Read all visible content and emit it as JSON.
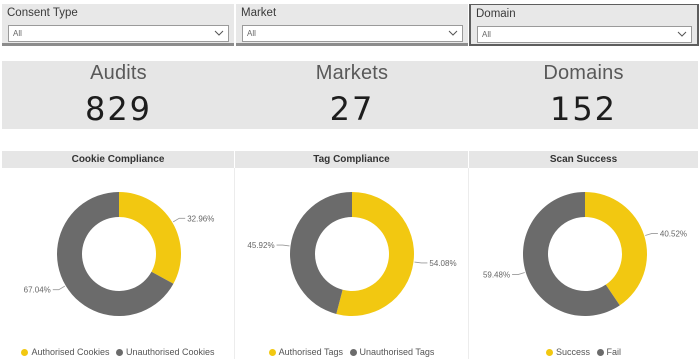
{
  "colors": {
    "accent": "#f2c811",
    "neutral": "#6b6b6b"
  },
  "filters": [
    {
      "label": "Consent Type",
      "value": "All",
      "icon": "chevron-down-icon"
    },
    {
      "label": "Market",
      "value": "All",
      "icon": "chevron-down-icon"
    },
    {
      "label": "Domain",
      "value": "All",
      "icon": "chevron-down-icon"
    }
  ],
  "kpis": [
    {
      "title": "Audits",
      "value": "829"
    },
    {
      "title": "Markets",
      "value": "27"
    },
    {
      "title": "Domains",
      "value": "152"
    }
  ],
  "chart_data": [
    {
      "type": "pie",
      "title": "Cookie Compliance",
      "categories": [
        "Authorised Cookies",
        "Unauthorised Cookies"
      ],
      "values": [
        32.96,
        67.04
      ],
      "labels": [
        "32.96%",
        "67.04%"
      ],
      "colors": [
        "#f2c811",
        "#6b6b6b"
      ],
      "legend": "bottom"
    },
    {
      "type": "pie",
      "title": "Tag Compliance",
      "categories": [
        "Authorised Tags",
        "Unauthorised Tags"
      ],
      "values": [
        54.08,
        45.92
      ],
      "labels": [
        "54.08%",
        "45.92%"
      ],
      "colors": [
        "#f2c811",
        "#6b6b6b"
      ],
      "legend": "bottom"
    },
    {
      "type": "pie",
      "title": "Scan Success",
      "categories": [
        "Success",
        "Fail"
      ],
      "values": [
        40.52,
        59.48
      ],
      "labels": [
        "40.52%",
        "59.48%"
      ],
      "colors": [
        "#f2c811",
        "#6b6b6b"
      ],
      "legend": "bottom"
    }
  ]
}
